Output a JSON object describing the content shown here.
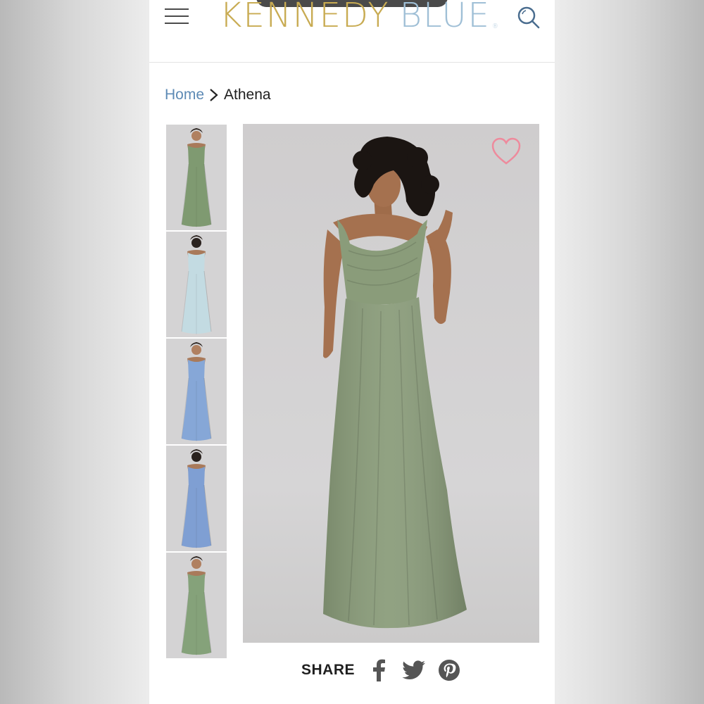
{
  "header": {
    "menu_icon": "hamburger-menu-icon",
    "logo_part1": "KENNEDY",
    "logo_part2": "BLUE",
    "logo_mark": "®",
    "search_icon": "search-icon"
  },
  "breadcrumb": {
    "home": "Home",
    "separator_icon": "chevron-right-icon",
    "current": "Athena"
  },
  "gallery": {
    "thumbnails": [
      {
        "dress_color": "#7f9a71",
        "view": "front"
      },
      {
        "dress_color": "#c3dbe2",
        "view": "back"
      },
      {
        "dress_color": "#86a7d7",
        "view": "front"
      },
      {
        "dress_color": "#7f9fd3",
        "view": "back"
      },
      {
        "dress_color": "#85a27a",
        "view": "front"
      }
    ],
    "main_dress_color": "#8a9c7a",
    "favorite_icon": "heart-icon",
    "favorite_color": "#ee8a9c"
  },
  "share": {
    "label": "SHARE",
    "icons": [
      "facebook-icon",
      "twitter-icon",
      "pinterest-icon"
    ],
    "icon_color": "#555555"
  },
  "colors": {
    "logo_gold": "#c8ab52",
    "logo_blue": "#9fbfd6",
    "link_blue": "#5d8ab5"
  }
}
